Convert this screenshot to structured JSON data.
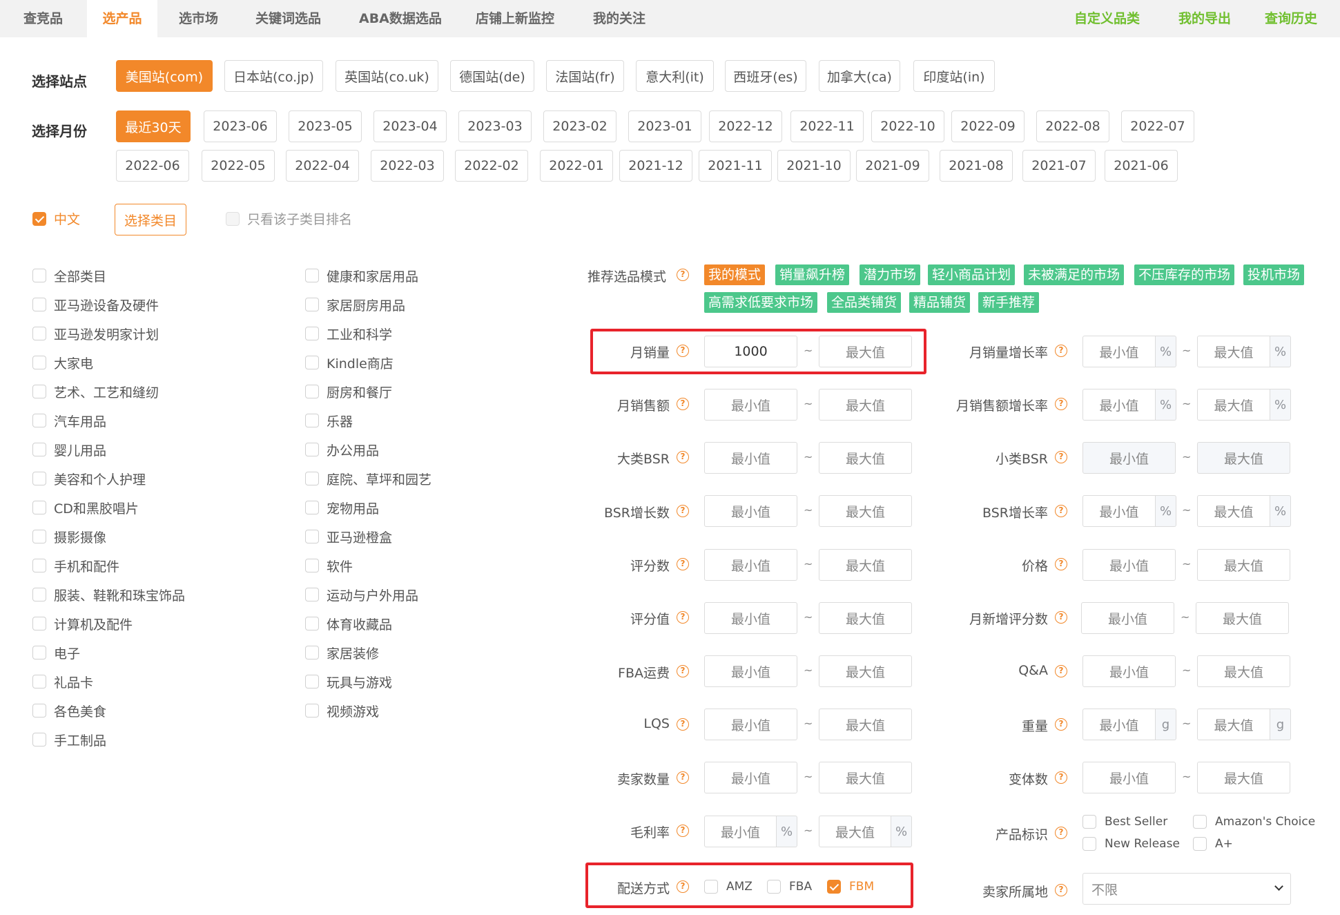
{
  "nav": {
    "tabs": [
      "查竞品",
      "选产品",
      "选市场",
      "关键词选品",
      "ABA数据选品",
      "店铺上新监控",
      "我的关注"
    ],
    "active_tab": "选产品",
    "right_links": [
      "自定义品类",
      "我的导出",
      "查询历史"
    ]
  },
  "station": {
    "label": "选择站点",
    "options": [
      "美国站(com)",
      "日本站(co.jp)",
      "英国站(co.uk)",
      "德国站(de)",
      "法国站(fr)",
      "意大利(it)",
      "西班牙(es)",
      "加拿大(ca)",
      "印度站(in)"
    ],
    "selected": "美国站(com)"
  },
  "month": {
    "label": "选择月份",
    "row1": [
      "最近30天",
      "2023-06",
      "2023-05",
      "2023-04",
      "2023-03",
      "2023-02",
      "2023-01",
      "2022-12",
      "2022-11",
      "2022-10",
      "2022-09",
      "2022-08",
      "2022-07"
    ],
    "row2": [
      "2022-06",
      "2022-05",
      "2022-04",
      "2022-03",
      "2022-02",
      "2022-01",
      "2021-12",
      "2021-11",
      "2021-10",
      "2021-09",
      "2021-08",
      "2021-07",
      "2021-06"
    ],
    "selected": "最近30天"
  },
  "options": {
    "chinese_label": "中文",
    "chinese_checked": true,
    "choose_category_label": "选择类目",
    "subcat_only_label": "只看该子类目排名"
  },
  "categories": {
    "col1": [
      "全部类目",
      "亚马逊设备及硬件",
      "亚马逊发明家计划",
      "大家电",
      "艺术、工艺和缝纫",
      "汽车用品",
      "婴儿用品",
      "美容和个人护理",
      "CD和黑胶唱片",
      "摄影摄像",
      "手机和配件",
      "服装、鞋靴和珠宝饰品",
      "计算机及配件",
      "电子",
      "礼品卡",
      "各色美食",
      "手工制品"
    ],
    "col2": [
      "健康和家居用品",
      "家居厨房用品",
      "工业和科学",
      "Kindle商店",
      "厨房和餐厅",
      "乐器",
      "办公用品",
      "庭院、草坪和园艺",
      "宠物用品",
      "亚马逊橙盒",
      "软件",
      "运动与户外用品",
      "体育收藏品",
      "家居装修",
      "玩具与游戏",
      "视频游戏"
    ]
  },
  "recommend": {
    "label": "推荐选品模式",
    "tags": [
      "我的模式",
      "销量飙升榜",
      "潜力市场",
      "轻小商品计划",
      "未被满足的市场",
      "不压库存的市场",
      "投机市场",
      "高需求低要求市场",
      "全品类铺货",
      "精品铺货",
      "新手推荐"
    ]
  },
  "placeholders": {
    "min": "最小值",
    "max": "最大值"
  },
  "filters": {
    "monthly_sales": {
      "label": "月销量",
      "min_value": "1000"
    },
    "monthly_sales_growth": {
      "label": "月销量增长率",
      "unit": "%"
    },
    "monthly_revenue": {
      "label": "月销售额"
    },
    "monthly_revenue_growth": {
      "label": "月销售额增长率",
      "unit": "%"
    },
    "main_bsr": {
      "label": "大类BSR"
    },
    "sub_bsr": {
      "label": "小类BSR"
    },
    "bsr_growth_count": {
      "label": "BSR增长数"
    },
    "bsr_growth_rate": {
      "label": "BSR增长率",
      "unit": "%"
    },
    "rating_count": {
      "label": "评分数"
    },
    "price": {
      "label": "价格"
    },
    "rating_value": {
      "label": "评分值"
    },
    "monthly_new_ratings": {
      "label": "月新增评分数"
    },
    "fba_fee": {
      "label": "FBA运费"
    },
    "qa": {
      "label": "Q&A"
    },
    "lqs": {
      "label": "LQS"
    },
    "weight": {
      "label": "重量",
      "unit": "g"
    },
    "seller_count": {
      "label": "卖家数量"
    },
    "variant_count": {
      "label": "变体数"
    },
    "gross_margin": {
      "label": "毛利率",
      "unit": "%"
    },
    "product_badge": {
      "label": "产品标识",
      "options": [
        "Best Seller",
        "Amazon's Choice",
        "New Release",
        "A+"
      ]
    },
    "delivery": {
      "label": "配送方式",
      "options": [
        "AMZ",
        "FBA",
        "FBM"
      ],
      "checked": "FBM"
    },
    "seller_location": {
      "label": "卖家所属地",
      "value": "不限"
    }
  },
  "colors": {
    "accent": "#f2882a",
    "tag_green": "#4cc78b",
    "link_green": "#70bf2e",
    "highlight_red": "#e8232b"
  }
}
